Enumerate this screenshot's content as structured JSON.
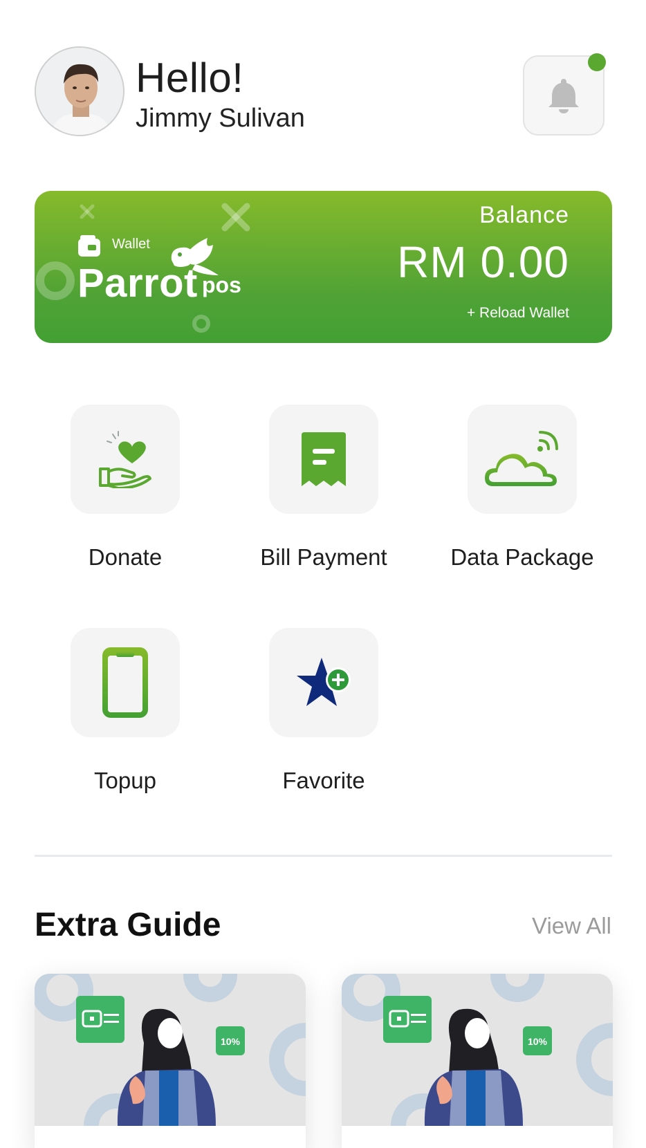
{
  "header": {
    "greeting": "Hello!",
    "user_name": "Jimmy Sulivan",
    "avatar_icon": "user-photo",
    "notification_icon": "bell-icon",
    "notification_dot_color": "#5aa830"
  },
  "wallet": {
    "label": "Wallet",
    "brand_main": "Parrot",
    "brand_sub": "pos",
    "balance_label": "Balance",
    "balance_amount": "RM 0.00",
    "reload_label": "+ Reload Wallet",
    "gradient_top": "#86ba2b",
    "gradient_bottom": "#43a033"
  },
  "services": [
    {
      "label": "Donate",
      "icon": "donate-hand-heart-icon"
    },
    {
      "label": "Bill Payment",
      "icon": "receipt-icon"
    },
    {
      "label": "Data Package",
      "icon": "cloud-signal-icon"
    },
    {
      "label": "Topup",
      "icon": "phone-icon"
    },
    {
      "label": "Favorite",
      "icon": "star-plus-icon"
    }
  ],
  "guide": {
    "title": "Extra Guide",
    "view_all": "View All",
    "cards": [
      {
        "badge": "10%"
      },
      {
        "badge": "10%"
      }
    ]
  },
  "colors": {
    "accent_green": "#4fa236",
    "star_navy": "#0f2a7a",
    "tile_bg": "#f4f4f4"
  }
}
